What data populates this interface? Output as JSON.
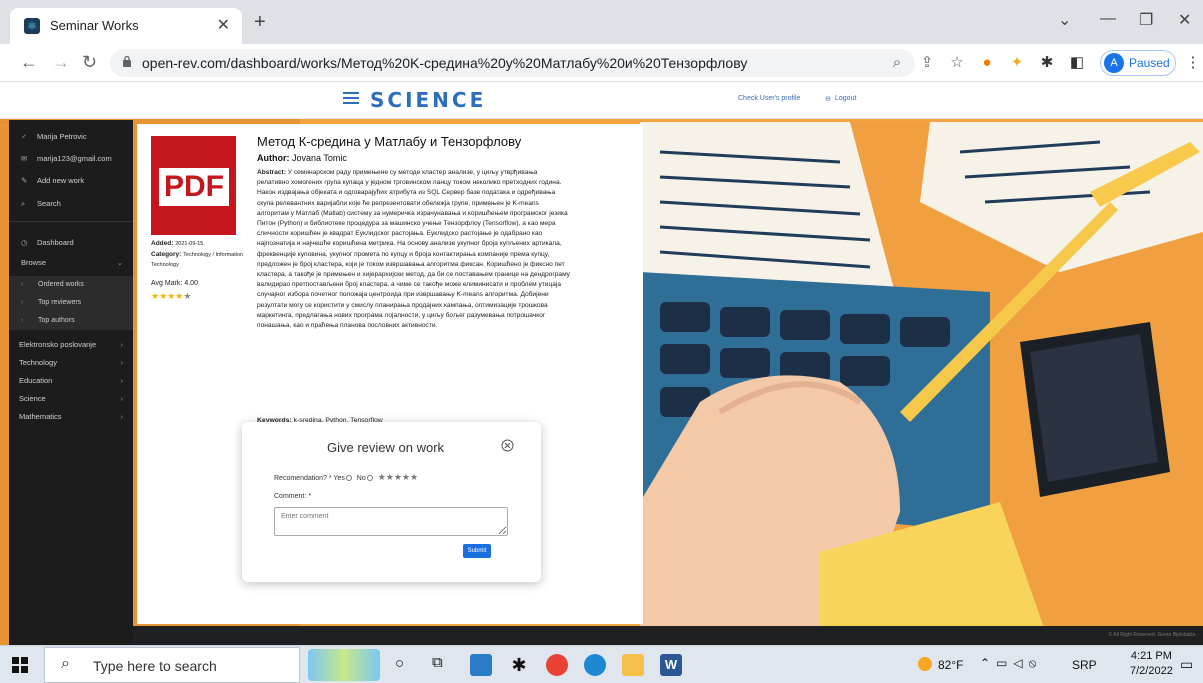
{
  "browser": {
    "tab_title": "Seminar Works",
    "url": "open-rev.com/dashboard/works/Метод%20K-средина%20у%20Матлабу%20и%20Тензорфлову",
    "profile_initial": "A",
    "profile_status": "Paused"
  },
  "header": {
    "brand": "SCIENCE",
    "links": [
      "Check User's profile",
      "Logout"
    ]
  },
  "sidebar": {
    "user_name": "Marija Petrovic",
    "email": "marija123@gmail.com",
    "add_new_work": "Add new work",
    "search": "Search",
    "dashboard": "Dashboard",
    "browse": "Browse",
    "browse_items": [
      "Ordered works",
      "Top reviewers",
      "Top authors"
    ],
    "categories": [
      "Elektronsko poslovanje",
      "Technology",
      "Education",
      "Science",
      "Mathematics"
    ]
  },
  "work": {
    "pdf_label": "PDF",
    "title": "Метод К-средина у Матлабу и Тензорфлову",
    "author_label": "Author:",
    "author": "Jovana Tomic",
    "abstract_label": "Abstract:",
    "abstract": "У семинарском раду примењене су методе кластер анализе, у циљу утврђивања релативно хомогених група купаца у једном трговинском ланцу током неколико претходних година. Након издвајања објеката и одговарајућих атрибута из SQL Сервер базе података и одређивања скупа релевантних варијабли које ће репрезентовати обележја групе, примењен је K-means алгоритам у Матлаб (Matlab) систему за нумеричка израчунавања и коришћењем програмског језика Питон (Python) и библиотеке процедура за машинско учење Тензорфлоу (Tensorflow), а као мера сличности коришћен је квадрат Еуклидског растојања. Еуклидско растојање је одабрано као најпознатија и најчешће коришћена метрика. На основу анализе укупног броја купљених артикала, фреквенције куповина, укупног промета по купцу и броја контактирања компаније према купцу, предложен је број кластера, који је током извршавања алгоритма фиксан. Коришћено је фиксно пет кластера, а такође је примењен и хијерархијски метод, да би се поставањем границе на дендрограму валидирао претпостављени број кластера, а чиме се такође може елиминисати и проблем утицаја случајног избора почетног положаја центроида при извршавању K-means алгоритма. Добијени резултати могу се користити у смислу планирања продајних кампања, оптимизације трошкова маркетинга, предлагања нових програма лојалности, у циљу бољег разумевања потрошачког понашања, као и праћења планова пословних активности.",
    "keywords_label": "Keywords:",
    "keywords": "k-sredina, Python, Tensorflow",
    "added_label": "Added:",
    "added": "2021-09-15",
    "category_label": "Category:",
    "category": "Technology / Information Technology",
    "avg_mark_label": "Avg Mark:",
    "avg_mark": "4.00",
    "rating": 4,
    "rating_max": 5
  },
  "review_modal": {
    "title": "Give review on work",
    "recommendation_label": "Recomendation? *",
    "yes": "Yes",
    "no": "No",
    "comment_label": "Comment: *",
    "comment_placeholder": "Enter comment",
    "submit": "Submit"
  },
  "footer": {
    "text": "© All Right Reserved. Goran Bjelobaba"
  },
  "taskbar": {
    "search_placeholder": "Type here to search",
    "weather": "82°F",
    "language": "SRP",
    "time": "4:21 PM",
    "date": "7/2/2022"
  },
  "colors": {
    "accent": "#1a6fe0",
    "pdf_red": "#c4161c",
    "star": "#f5b301",
    "sidebar": "#1c1c1c",
    "brand": "#2f6dbd"
  }
}
